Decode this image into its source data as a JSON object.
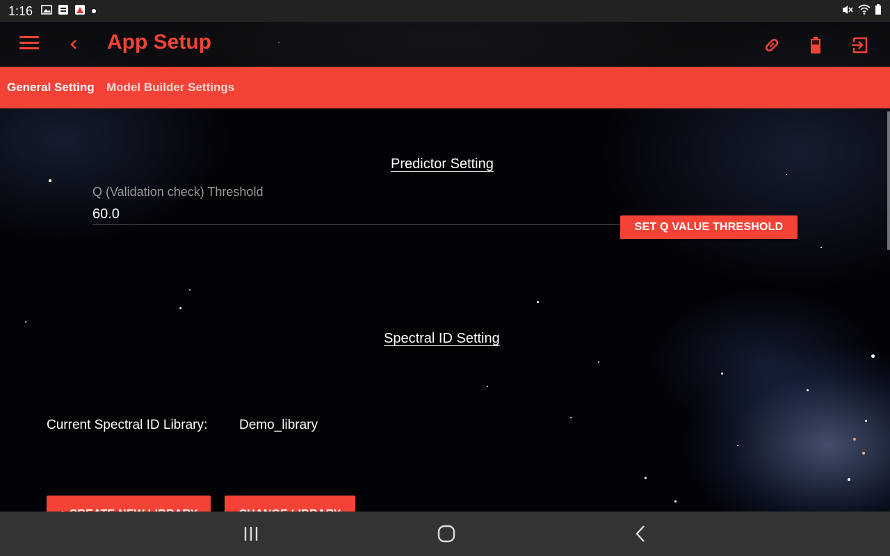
{
  "status_bar": {
    "time": "1:16",
    "left_icons": [
      "gallery-icon",
      "notification-icon",
      "app-notification-icon",
      "dot-icon"
    ],
    "right_icons": [
      "mute-icon",
      "wifi-icon",
      "battery-icon"
    ]
  },
  "app_bar": {
    "title": "App Setup",
    "icons": [
      "menu-icon",
      "back-arrow-icon",
      "link-icon",
      "battery-icon",
      "logout-icon"
    ]
  },
  "tabs": [
    {
      "label": "General Setting",
      "active": true
    },
    {
      "label": "Model Builder Settings",
      "active": false
    }
  ],
  "predictor": {
    "title": "Predictor Setting",
    "q_label": "Q (Validation check) Threshold",
    "q_value": "60.0",
    "button_label": "SET Q VALUE THRESHOLD"
  },
  "spectral": {
    "title": "Spectral ID Setting",
    "library_label": "Current Spectral ID Library:",
    "library_value": "Demo_library",
    "create_button_label": "+ CREATE NEW LIBRARY",
    "change_button_label": "CHANGE LIBRARY"
  },
  "nav_bar": {
    "icons": [
      "recents-icon",
      "home-icon",
      "back-icon"
    ]
  },
  "colors": {
    "accent": "#f44336",
    "status_bar": "#222222",
    "nav_bar": "#333333"
  }
}
